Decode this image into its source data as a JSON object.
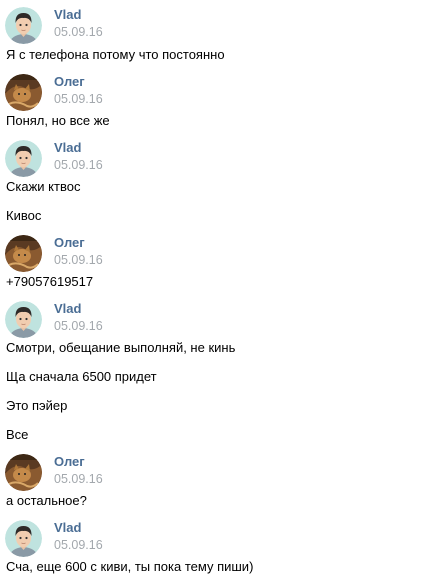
{
  "colors": {
    "author": "#4a6d94",
    "date": "#a3a8ad",
    "text": "#000000",
    "background": "#ffffff"
  },
  "users": {
    "vlad": {
      "name": "Vlad",
      "avatar_icon": "cartoon-man-avatar-icon"
    },
    "oleg": {
      "name": "Олег",
      "avatar_icon": "cat-photo-avatar-icon"
    }
  },
  "blocks": [
    {
      "author": "Vlad",
      "date": "05.09.16",
      "messages": [
        "Я с телефона потому что постоянно"
      ]
    },
    {
      "author": "Олег",
      "date": "05.09.16",
      "messages": [
        "Понял, но все же"
      ]
    },
    {
      "author": "Vlad",
      "date": "05.09.16",
      "messages": [
        "Скажи ктвос",
        "Кивос"
      ]
    },
    {
      "author": "Олег",
      "date": "05.09.16",
      "messages": [
        "+79057619517"
      ]
    },
    {
      "author": "Vlad",
      "date": "05.09.16",
      "messages": [
        "Смотри, обещание выполняй, не кинь",
        "Ща сначала 6500 придет",
        "Это пэйер",
        "Все"
      ]
    },
    {
      "author": "Олег",
      "date": "05.09.16",
      "messages": [
        "а остальное?"
      ]
    },
    {
      "author": "Vlad",
      "date": "05.09.16",
      "messages": [
        "Сча, еще 600 с киви, ты пока тему пиши)"
      ]
    }
  ]
}
